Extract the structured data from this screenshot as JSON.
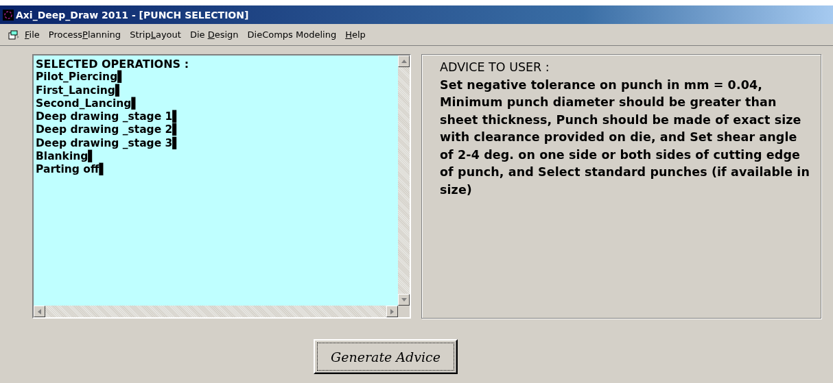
{
  "window": {
    "title": "Axi_Deep_Draw 2011 - [PUNCH SELECTION]"
  },
  "menu": [
    {
      "key": "F",
      "after": "ile"
    },
    {
      "before": "Process",
      "key": "P",
      "after": "lanning"
    },
    {
      "before": "Strip",
      "key": "L",
      "after": "ayout"
    },
    {
      "before": "Die ",
      "key": "D",
      "after": "esign"
    },
    {
      "before": "DieComps Modeling"
    },
    {
      "key": "H",
      "after": "elp"
    }
  ],
  "operations": {
    "heading": "SELECTED OPERATIONS :",
    "items": [
      "Pilot_Piercing▌",
      "First_Lancing▌",
      "Second_Lancing▌",
      "Deep drawing _stage 1▌",
      "Deep drawing _stage 2▌",
      "Deep drawing _stage 3▌",
      "Blanking▌",
      "Parting off▌"
    ]
  },
  "advice": {
    "heading": "ADVICE TO USER :",
    "text": "Set negative tolerance on punch in mm = 0.04, Minimum punch diameter should be greater than sheet thickness, Punch should be made of exact size with clearance provided on die, and Set shear angle of 2-4 deg. on one side or both sides of cutting edge of punch, and Select standard punches (if available in size)"
  },
  "buttons": [
    {
      "label": "Generate Advice"
    }
  ]
}
